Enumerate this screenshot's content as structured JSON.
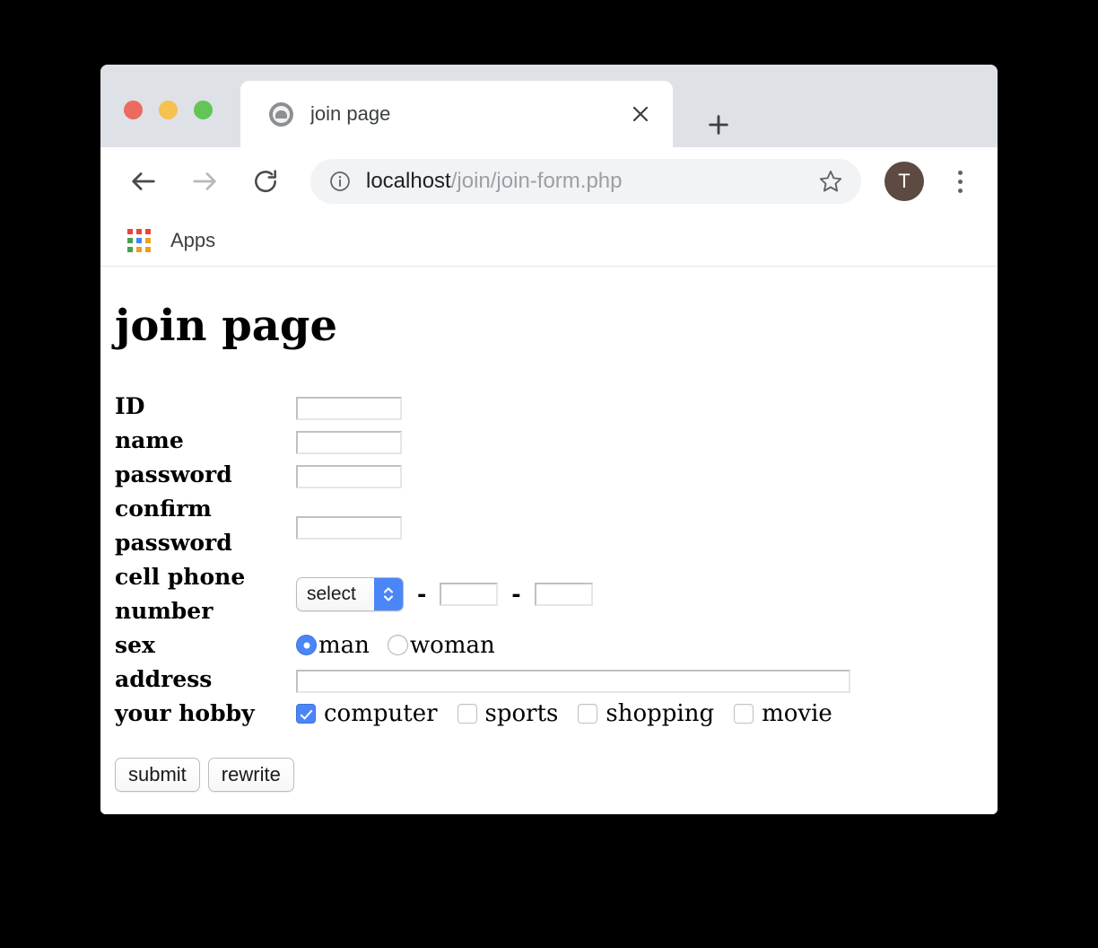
{
  "browser": {
    "tab": {
      "title": "join page",
      "favicon": "globe-favicon",
      "close_label": "×"
    },
    "new_tab_label": "+",
    "toolbar": {
      "back_label": "Back",
      "forward_label": "Forward",
      "reload_label": "Reload",
      "url_host": "localhost",
      "url_path": "/join/join-form.php",
      "info_icon": "info-circle-icon",
      "star_icon": "bookmark-star-icon",
      "avatar_initial": "T",
      "avatar_color": "#5d4a42",
      "menu_icon": "three-dot-menu-icon"
    },
    "bookmarks": {
      "apps_label": "Apps"
    }
  },
  "page": {
    "title": "join page",
    "rows": [
      {
        "label": "ID",
        "type": "text"
      },
      {
        "label": "name",
        "type": "text"
      },
      {
        "label": "password",
        "type": "text"
      },
      {
        "label": "confirm password",
        "type": "text"
      },
      {
        "label": "cell phone number",
        "type": "phone"
      },
      {
        "label": "sex",
        "type": "radio"
      },
      {
        "label": "address",
        "type": "text-wide"
      },
      {
        "label": "your hobby",
        "type": "checkbox"
      }
    ],
    "inputs": {
      "id": "",
      "name": "",
      "password": "",
      "confirm_password": "",
      "phone_prefix_selected": "select",
      "phone_middle": "",
      "phone_last": "",
      "address": ""
    },
    "phone_separator": "-",
    "sex_options": [
      {
        "label": "man",
        "checked": true
      },
      {
        "label": "woman",
        "checked": false
      }
    ],
    "hobby_options": [
      {
        "label": "computer",
        "checked": true
      },
      {
        "label": "sports",
        "checked": false
      },
      {
        "label": "shopping",
        "checked": false
      },
      {
        "label": "movie",
        "checked": false
      }
    ],
    "buttons": {
      "submit": "submit",
      "rewrite": "rewrite"
    }
  },
  "colors": {
    "accent_blue": "#4a86f7",
    "tabstrip_bg": "#dee1e6",
    "omnibox_bg": "#f1f3f4"
  }
}
